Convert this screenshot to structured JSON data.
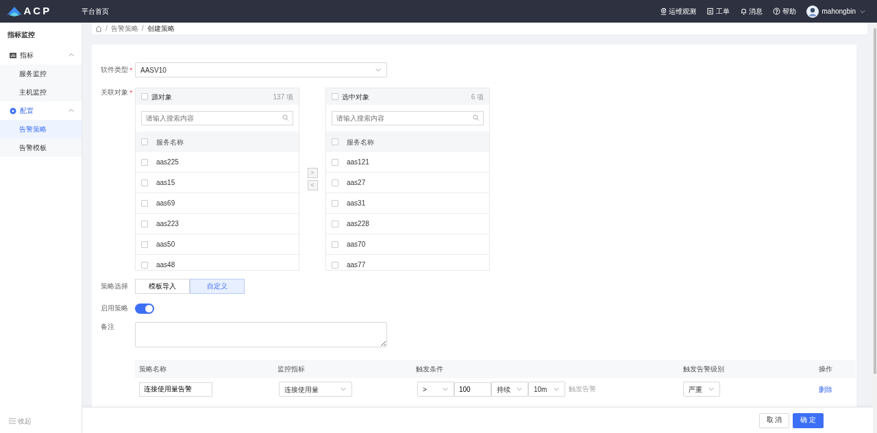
{
  "header": {
    "logo": "ACP",
    "home_link": "平台首页",
    "nav": [
      {
        "kind": "observe",
        "label": "运维观测"
      },
      {
        "kind": "ticket",
        "label": "工单"
      },
      {
        "kind": "bell",
        "label": "消息"
      },
      {
        "kind": "help",
        "label": "帮助"
      }
    ],
    "user": "mahongbin"
  },
  "sidebar": {
    "title": "指标监控",
    "groups": [
      {
        "kind": "chart",
        "label": "指标",
        "expanded": true,
        "children": [
          {
            "label": "服务监控",
            "selected": false
          },
          {
            "label": "主机监控",
            "selected": false
          }
        ]
      },
      {
        "kind": "config",
        "label": "配置",
        "expanded": true,
        "children": [
          {
            "label": "告警策略",
            "selected": true
          },
          {
            "label": "告警模板",
            "selected": false
          }
        ]
      }
    ],
    "collapse": "收起"
  },
  "breadcrumb": [
    {
      "separator": "/",
      "label": "告警策略"
    },
    {
      "separator": "/",
      "label": "创建策略"
    }
  ],
  "form": {
    "software_type": {
      "label": "软件类型",
      "required_mark": "*",
      "value": "AASV10"
    },
    "related": {
      "label": "关联对象",
      "required_mark": "*",
      "source": {
        "title": "源对象",
        "all_checked": false,
        "count": "137 项",
        "placeholder": "请输入搜索内容",
        "column": "服务名称",
        "items": [
          {
            "name": "aas225",
            "checked": false
          },
          {
            "name": "aas15",
            "checked": false
          },
          {
            "name": "aas69",
            "checked": false
          },
          {
            "name": "aas223",
            "checked": false
          },
          {
            "name": "aas50",
            "checked": false
          },
          {
            "name": "aas48",
            "checked": false
          }
        ]
      },
      "target": {
        "title": "选中对象",
        "all_checked": false,
        "count": "6 项",
        "placeholder": "请输入搜索内容",
        "column": "服务名称",
        "items": [
          {
            "name": "aas121",
            "checked": false
          },
          {
            "name": "aas27",
            "checked": false
          },
          {
            "name": "aas31",
            "checked": false
          },
          {
            "name": "aas228",
            "checked": false
          },
          {
            "name": "aas70",
            "checked": false
          },
          {
            "name": "aas77",
            "checked": false
          }
        ]
      },
      "move_right": ">",
      "move_left": "<"
    },
    "strategy": {
      "label": "策略选择",
      "options": [
        {
          "label": "模板导入",
          "selected": false
        },
        {
          "label": "自定义",
          "selected": true
        }
      ]
    },
    "enable": {
      "label": "启用策略",
      "on": true
    },
    "remark": {
      "label": "备注"
    },
    "rules": {
      "columns": [
        "策略名称",
        "监控指标",
        "触发条件",
        "触发告警级别",
        "操作"
      ],
      "rows": [
        {
          "name": "连接使用量告警",
          "metric": "连接使用量",
          "operator": ">",
          "threshold": "100",
          "mode": "持续",
          "duration": "10m",
          "hint": "触发告警",
          "level": "严重",
          "action": "删除"
        }
      ]
    }
  },
  "footer": {
    "buttons": [
      {
        "label": "取 消",
        "kind": "default"
      },
      {
        "label": "确 定",
        "kind": "primary"
      }
    ]
  }
}
